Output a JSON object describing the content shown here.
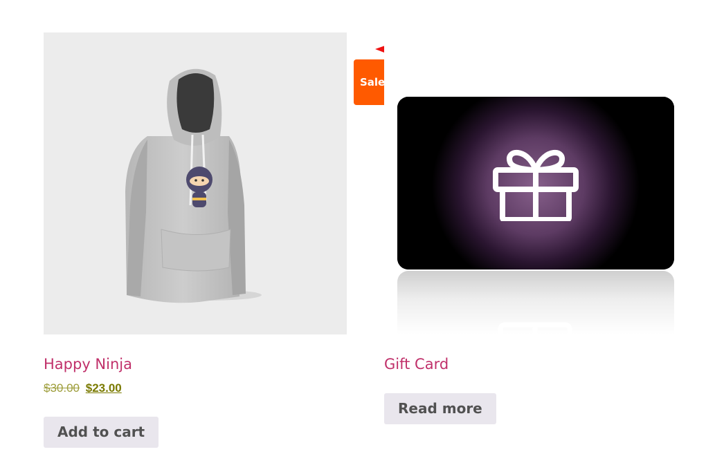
{
  "products": [
    {
      "title": "Happy Ninja",
      "regular_price": "$30.00",
      "sale_price": "$23.00",
      "button_label": "Add to cart",
      "badge": "Sale!",
      "image": "hoodie-with-ninja-logo"
    },
    {
      "title": "Gift Card",
      "button_label": "Read more",
      "image": "gift-card-with-gift-icon"
    }
  ],
  "colors": {
    "title": "#c0306a",
    "sale_badge": "#ff5a00",
    "button_bg": "#e9e6ed",
    "price": "#7a7a00",
    "annotation_arrow": "#ee1111"
  },
  "annotation": {
    "icon": "red-arrow-pointing-left"
  }
}
